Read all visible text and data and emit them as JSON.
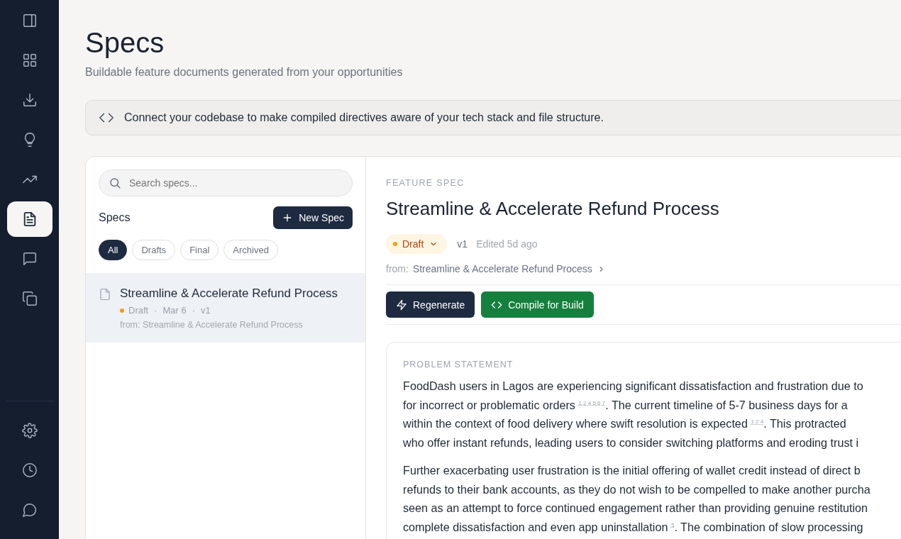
{
  "nav": {
    "top": [
      {
        "kind": "panel",
        "selected": false
      },
      {
        "kind": "grid",
        "selected": false
      },
      {
        "kind": "download",
        "selected": false
      },
      {
        "kind": "bulb",
        "selected": false
      },
      {
        "kind": "trend",
        "selected": false
      },
      {
        "kind": "doc",
        "selected": true
      },
      {
        "kind": "chat",
        "selected": false
      },
      {
        "kind": "copy",
        "selected": false
      }
    ],
    "bottom": [
      {
        "kind": "gear",
        "selected": false
      },
      {
        "kind": "clock",
        "selected": false
      },
      {
        "kind": "bubble",
        "selected": false
      }
    ]
  },
  "header": {
    "title": "Specs",
    "subtitle": "Buildable feature documents generated from your opportunities"
  },
  "banner": {
    "text": "Connect your codebase to make compiled directives aware of your tech stack and file structure."
  },
  "spec_list": {
    "search": {
      "placeholder": "Search specs..."
    },
    "heading": "Specs",
    "new_button": "New Spec",
    "filters": [
      {
        "label": "All",
        "selected": true
      },
      {
        "label": "Drafts",
        "selected": false
      },
      {
        "label": "Final",
        "selected": false
      },
      {
        "label": "Archived",
        "selected": false
      }
    ],
    "separator": "·",
    "items": [
      {
        "title": "Streamline & Accelerate Refund Process",
        "status": "Draft",
        "color": "#f59e0b",
        "date": "Mar 6",
        "version": "v1",
        "from": "from: Streamline & Accelerate Refund Process",
        "selected": true
      }
    ]
  },
  "detail": {
    "eyebrow": "FEATURE SPEC",
    "title": "Streamline & Accelerate Refund Process",
    "status": {
      "label": "Draft",
      "color": "#f59e0b"
    },
    "version": "v1",
    "edited": "Edited 5d ago",
    "from_label": "from:",
    "from_link": "Streamline & Accelerate Refund Process",
    "buttons": [
      {
        "kind": "regenerate",
        "label": "Regenerate"
      },
      {
        "kind": "compile",
        "label": "Compile for Build"
      }
    ],
    "section": {
      "label": "PROBLEM STATEMENT",
      "paragraphs": [
        [
          "FoodDash users in Lagos are experiencing significant dissatisfaction and frustration due to",
          "for incorrect or problematic orders $^{1 2 4 5 6 7}$. The current timeline of 5-7 business days for a",
          "within the context of food delivery where swift resolution is expected $^{1 2 4}$. This protracted",
          "who offer instant refunds, leading users to consider switching platforms and eroding trust i"
        ],
        [
          "Further exacerbating user frustration is the initial offering of wallet credit instead of direct b",
          "refunds to their bank accounts, as they do not wish to be compelled to make another purcha",
          "seen as an attempt to force continued engagement rather than providing genuine restitution",
          "complete dissatisfaction and even app uninstallation $^{5}$. The combination of slow processing"
        ]
      ]
    }
  }
}
